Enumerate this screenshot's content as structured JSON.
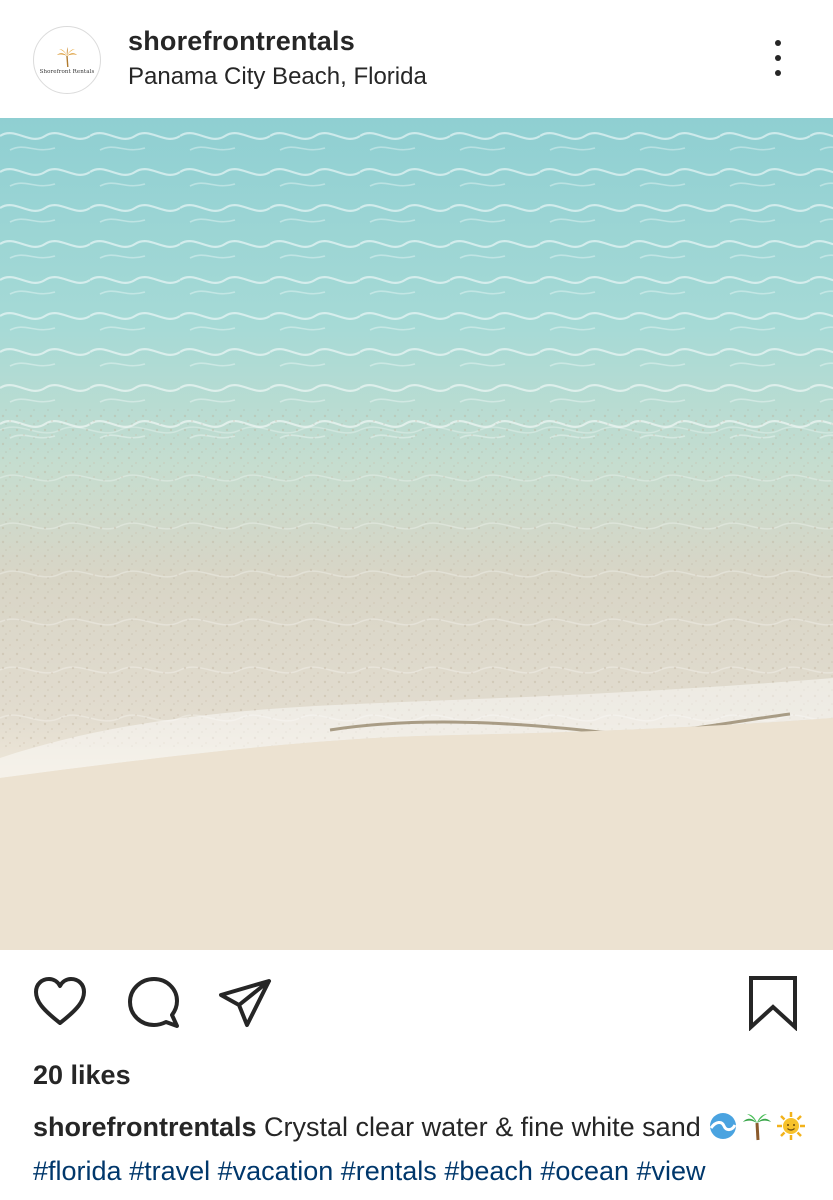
{
  "header": {
    "username": "shorefrontrentals",
    "location": "Panama City Beach, Florida",
    "avatar_text": "Shorefront Rentals"
  },
  "actions": {
    "icons": [
      "heart-icon",
      "comment-icon",
      "share-icon",
      "bookmark-icon"
    ]
  },
  "post": {
    "likes": "20 likes",
    "caption_user": "shorefrontrentals",
    "caption_text": " Crystal clear water & fine white sand ",
    "emojis": [
      "wave-emoji",
      "palm-tree-emoji",
      "sun-emoji"
    ],
    "hashtags": [
      "#florida",
      "#travel",
      "#vacation",
      "#rentals"
    ],
    "hashtags_cut": "#beach #ocean #view #photography #paradise"
  },
  "colors": {
    "text": "#262626",
    "hashtag": "#00376b",
    "water": "#a8d8d6",
    "sand": "#ece3d4"
  }
}
